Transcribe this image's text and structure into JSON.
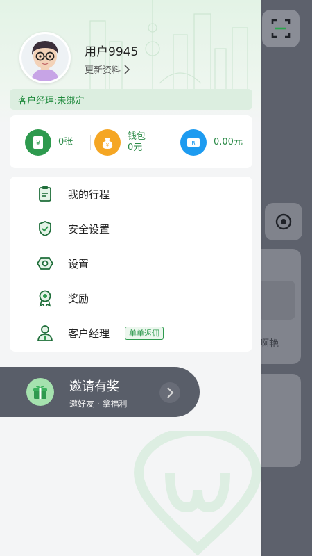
{
  "background": {
    "card_text": "啊艳"
  },
  "profile": {
    "username": "用户9945",
    "update_label": "更新资料",
    "manager_status": "客户经理:未绑定"
  },
  "wallet": {
    "coupons": "0张",
    "wallet_label": "钱包",
    "wallet_value": "0元",
    "balance": "0.00元"
  },
  "menu": {
    "items": [
      {
        "label": "我的行程",
        "icon": "clipboard-icon"
      },
      {
        "label": "安全设置",
        "icon": "shield-check-icon"
      },
      {
        "label": "设置",
        "icon": "hex-nut-icon"
      },
      {
        "label": "奖励",
        "icon": "award-ribbon-icon"
      },
      {
        "label": "客户经理",
        "icon": "person-icon",
        "badge": "单单返佣"
      }
    ]
  },
  "invite": {
    "title": "邀请有奖",
    "subtitle": "邀好友 · 拿福利"
  },
  "colors": {
    "accent": "#2e9a4e",
    "accent_light": "#dceee0",
    "overlay": "#5d616c",
    "coin_orange": "#f5a623",
    "coupon_blue": "#1d9bf0"
  }
}
